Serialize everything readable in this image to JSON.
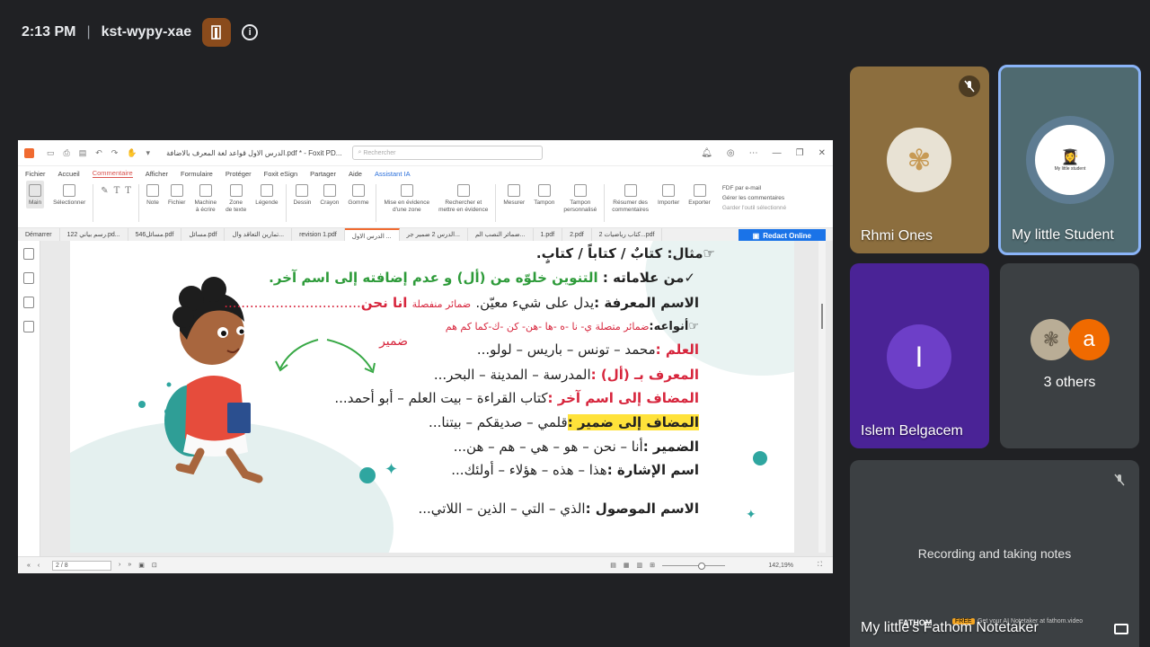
{
  "meeting": {
    "time": "2:13 PM",
    "separator": "|",
    "code": "kst-wypy-xae",
    "info_glyph": "i"
  },
  "app": {
    "doc_title": "الدرس الاول قواعد لغة المعرف بالاضافة.pdf * - Foxit PD...",
    "search_placeholder": "Rechercher",
    "menu": [
      "Fichier",
      "Accueil",
      "Commentaire",
      "Afficher",
      "Formulaire",
      "Protéger",
      "Foxit eSign",
      "Partager",
      "Aide",
      "Assistant IA"
    ],
    "menu_active_index": 2,
    "ribbon": {
      "main": "Main",
      "selectionner": "Sélectionner",
      "note": "Note",
      "fichier": "Fichier",
      "machine1": "Machine",
      "machine2": "à écrire",
      "zone1": "Zone",
      "zone2": "de texte",
      "legende": "Légende",
      "dessin": "Dessin",
      "crayon": "Crayon",
      "gomme": "Gomme",
      "mise1": "Mise en évidence",
      "mise2": "d'une zone",
      "rech1": "Rechercher et",
      "rech2": "mettre en évidence",
      "mesurer": "Mesurer",
      "tampon": "Tampon",
      "tampon_p1": "Tampon",
      "tampon_p2": "personnalisé",
      "resumer1": "Résumer des",
      "resumer2": "commentaires",
      "importer": "Importer",
      "exporter": "Exporter",
      "fdf": "FDF par e-mail",
      "gerer": "Gérer les commentaires",
      "garder": "Garder l'outil sélectionné"
    },
    "tabs": [
      "Démarrer",
      "122 رسم بياني.pd...",
      "546مسائل.pdf",
      "مسائل.pdf",
      "تمارين التعاقد وال...",
      "revision 1.pdf",
      "الدرس الاول ...",
      "الدرس 2 ضمير جر...",
      "ضمائر النصب الم...",
      "1.pdf",
      "2.pdf",
      "كتاب رياضيات 2...pdf"
    ],
    "current_tab_index": 6,
    "redact_label": "Redact Online",
    "page_indicator": "2 / 8",
    "zoom": "142,19%"
  },
  "lesson": {
    "line1": "مثال: كتابٌ / كتاباً / كتابٍ.",
    "line2_a": "من علاماته :",
    "line2_b": "التنوين خلوّه من (أل) و عدم إضافته إلى اسم آخر.",
    "line3_a": "الاسم المعرفة :",
    "line3_b": "يدل على شيء معيّن.",
    "line3_c": "ضمائر منفصلة",
    "line3_d": "انا نحن",
    "line4_a": "أنواعه:",
    "line4_b": "ضمائر متصلة ي- نا -ه -ها -هن- كن -ك-كما كم هم",
    "line4_c": "ضمير",
    "line5_a": "العلم :",
    "line5_b": "محمد – تونس – باريس – لولو...",
    "line6_a": "المعرف بـ (أل) :",
    "line6_b": "المدرسة – المدينة – البحر...",
    "line7_a": "المضاف إلى اسم آخر :",
    "line7_b": "كتاب القراءة – بيت العلم – أبو أحمد...",
    "line8_a": "المضاف إلى ضمير :",
    "line8_b": "قلمي – صديقكم – بيتنا...",
    "line9_a": "الضمير :",
    "line9_b": "أنا – نحن – هو – هي – هم – هن...",
    "line10_a": "اسم الإشارة :",
    "line10_b": "هذا – هذه – هؤلاء – أولئك...",
    "line11_a": "الاسم الموصول :",
    "line11_b": "الذي – التي – الذين – اللاتي..."
  },
  "participants": [
    {
      "name": "Rhmi Ones",
      "muted": true,
      "bg": "#8c6e3e"
    },
    {
      "name": "My little Student",
      "muted": false,
      "bg": "#4f6a70",
      "active": true,
      "avatar_text": "My little student"
    },
    {
      "name": "Islem Belgacem",
      "muted": false,
      "bg": "#4a2396",
      "initial": "I"
    },
    {
      "name": "3 others",
      "muted": false,
      "bg": "#3c4043",
      "initial": "a"
    }
  ],
  "notetaker": {
    "name": "My little's Fathom Notetaker",
    "status": "Recording and taking notes",
    "brand": "FATHOM",
    "free_badge": "FREE",
    "free_text": "Get your AI Notetaker at fathom.video",
    "muted": true
  },
  "colors": {
    "accent": "#f06a30",
    "active_border": "#8ab4f8",
    "redact": "#1a73e8"
  }
}
